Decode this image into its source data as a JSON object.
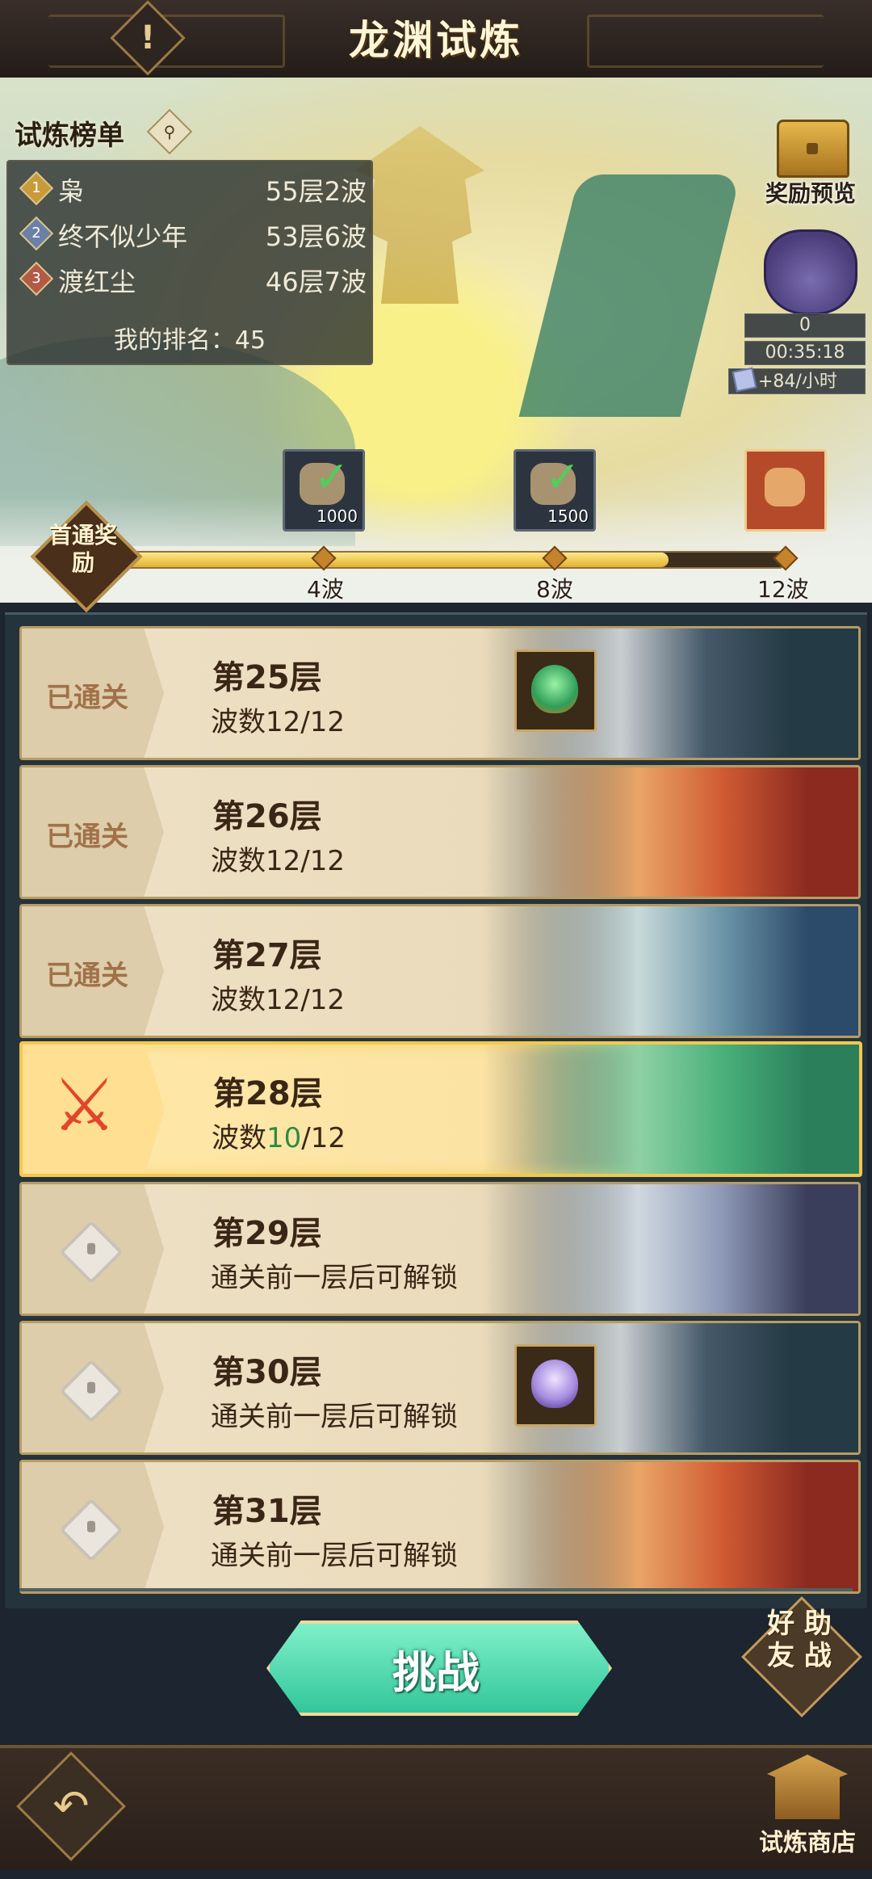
{
  "header": {
    "title": "龙渊试炼",
    "alert_icon": "exclamation-icon"
  },
  "leaderboard": {
    "title": "试炼榜单",
    "entries": [
      {
        "rank": "1",
        "name": "枭",
        "score": "55层2波"
      },
      {
        "rank": "2",
        "name": "终不似少年",
        "score": "53层6波"
      },
      {
        "rank": "3",
        "name": "渡红尘",
        "score": "46层7波"
      }
    ],
    "my_rank_label": "我的排名：45"
  },
  "reward_preview": {
    "label": "奖励预览"
  },
  "idle_bag": {
    "count": "0",
    "timer": "00:35:18",
    "rate": "+84/小时"
  },
  "first_clear": {
    "label": "首通奖励",
    "progress": 0.83,
    "milestones": [
      {
        "wave": "4波",
        "reward": "1000",
        "claimed": true
      },
      {
        "wave": "8波",
        "reward": "1500",
        "claimed": true
      },
      {
        "wave": "12波",
        "reward": "",
        "claimed": false
      }
    ]
  },
  "floors": [
    {
      "title": "第25层",
      "sub": "波数12/12",
      "status": "已通关",
      "state": "cleared",
      "reward": "green-egg-icon"
    },
    {
      "title": "第26层",
      "sub": "波数12/12",
      "status": "已通关",
      "state": "cleared"
    },
    {
      "title": "第27层",
      "sub": "波数12/12",
      "status": "已通关",
      "state": "cleared"
    },
    {
      "title": "第28层",
      "sub_prefix": "波数",
      "sub_current": "10",
      "sub_total": "/12",
      "state": "active"
    },
    {
      "title": "第29层",
      "sub": "通关前一层后可解锁",
      "state": "locked"
    },
    {
      "title": "第30层",
      "sub": "通关前一层后可解锁",
      "state": "locked",
      "reward": "purple-egg-icon"
    },
    {
      "title": "第31层",
      "sub": "通关前一层后可解锁",
      "state": "locked"
    }
  ],
  "actions": {
    "challenge": "挑战",
    "helper": "好友助战",
    "helper_lines": [
      "好 助",
      "友 战"
    ]
  },
  "footer": {
    "back_icon": "back-arrow-icon",
    "shop_label": "试炼商店"
  },
  "colors": {
    "accent": "#f3c84c",
    "button": "#33c69a",
    "progress": "#e2b12e"
  }
}
